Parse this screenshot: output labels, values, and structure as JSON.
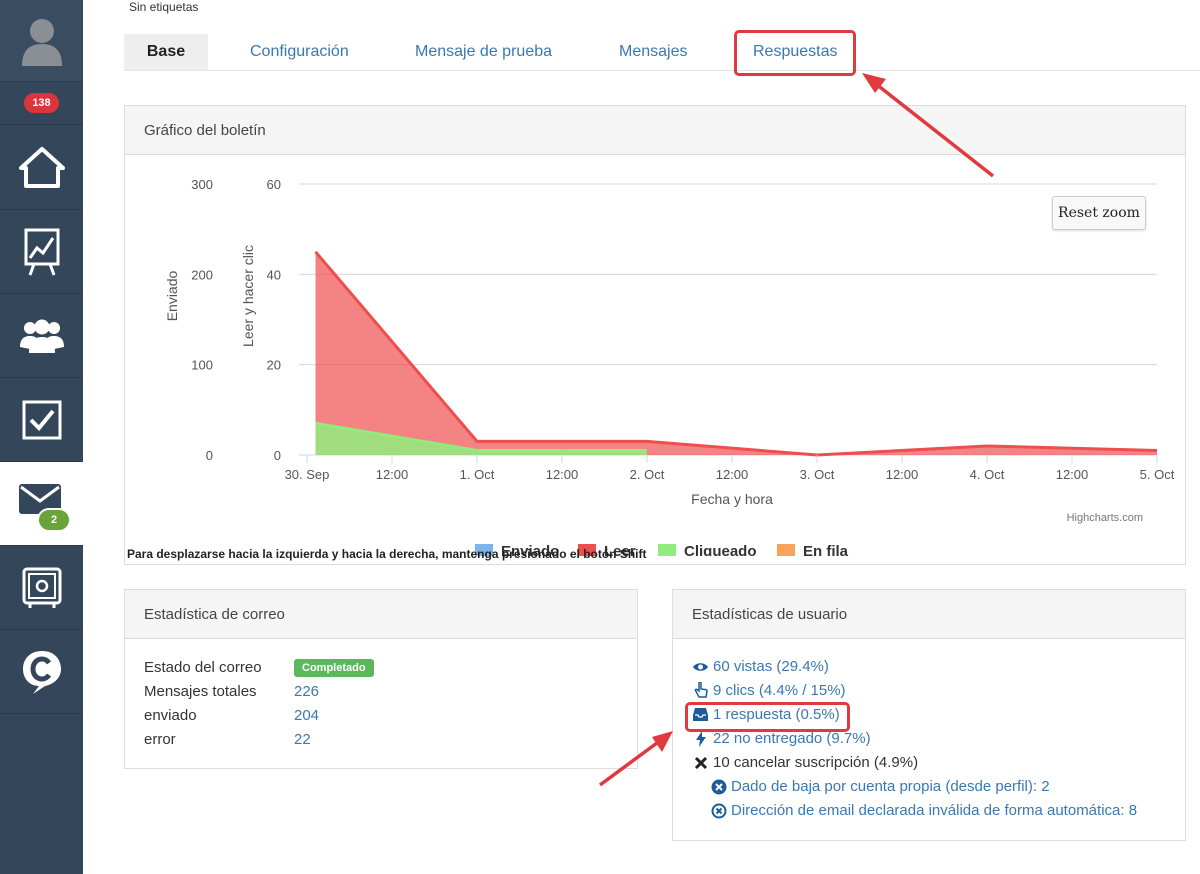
{
  "sidebar": {
    "notifications_badge": "138",
    "mail_badge": "2"
  },
  "header": {
    "tags_text": "Sin etiquetas"
  },
  "tabs": [
    {
      "label": "Base"
    },
    {
      "label": "Configuración"
    },
    {
      "label": "Mensaje de prueba"
    },
    {
      "label": "Mensajes"
    },
    {
      "label": "Respuestas"
    }
  ],
  "chart_panel": {
    "title": "Gráfico del boletín",
    "reset_zoom": "Reset zoom",
    "hint": "Para desplazarse hacia la izquierda y hacia la derecha, mantenga presionado el botón Shift",
    "credits": "Highcharts.com"
  },
  "chart_data": {
    "type": "area",
    "xlabel": "Fecha y hora",
    "y_axes": [
      {
        "label": "Enviado",
        "ticks": [
          "300",
          "200",
          "100",
          "0"
        ],
        "range": [
          0,
          300
        ]
      },
      {
        "label": "Leer y hacer clic",
        "ticks": [
          "60",
          "40",
          "20",
          "0"
        ],
        "range": [
          0,
          60
        ]
      }
    ],
    "x_ticks": [
      "30. Sep",
      "12:00",
      "1. Oct",
      "12:00",
      "2. Oct",
      "12:00",
      "3. Oct",
      "12:00",
      "4. Oct",
      "12:00",
      "5. Oct"
    ],
    "series": [
      {
        "name": "Enviado",
        "color": "#7cb5ec",
        "x": [],
        "values": []
      },
      {
        "name": "Leer",
        "color": "#f04e4e",
        "x": [
          0.05,
          1.0,
          2.0,
          3.0,
          4.0,
          5.0
        ],
        "values": [
          45,
          3,
          3,
          0,
          2,
          1
        ]
      },
      {
        "name": "Cliqueado",
        "color": "#90ed7d",
        "x": [
          0.05,
          1.0,
          2.0
        ],
        "values": [
          7,
          1,
          1
        ]
      },
      {
        "name": "En fila",
        "color": "#f7a35c",
        "x": [],
        "values": []
      }
    ],
    "grid": true,
    "legend": "bottom"
  },
  "mail_stats": {
    "title": "Estadística de correo",
    "rows": [
      {
        "label": "Estado del correo",
        "value": "Completado"
      },
      {
        "label": "Mensajes totales",
        "value": "226"
      },
      {
        "label": "enviado",
        "value": "204"
      },
      {
        "label": "error",
        "value": "22"
      }
    ]
  },
  "user_stats": {
    "title": "Estadísticas de usuario",
    "views": "60 vistas (29.4%)",
    "clicks": "9 clics (4.4% / 15%)",
    "replies": "1 respuesta (0.5%)",
    "bounced": "22 no entregado (9.7%)",
    "unsubscribed": "10 cancelar suscripción (4.9%)",
    "unsub_own": "Dado de baja por cuenta propia (desde perfil): 2",
    "unsub_invalid": "Dirección de email declarada inválida de forma automática: 8"
  }
}
